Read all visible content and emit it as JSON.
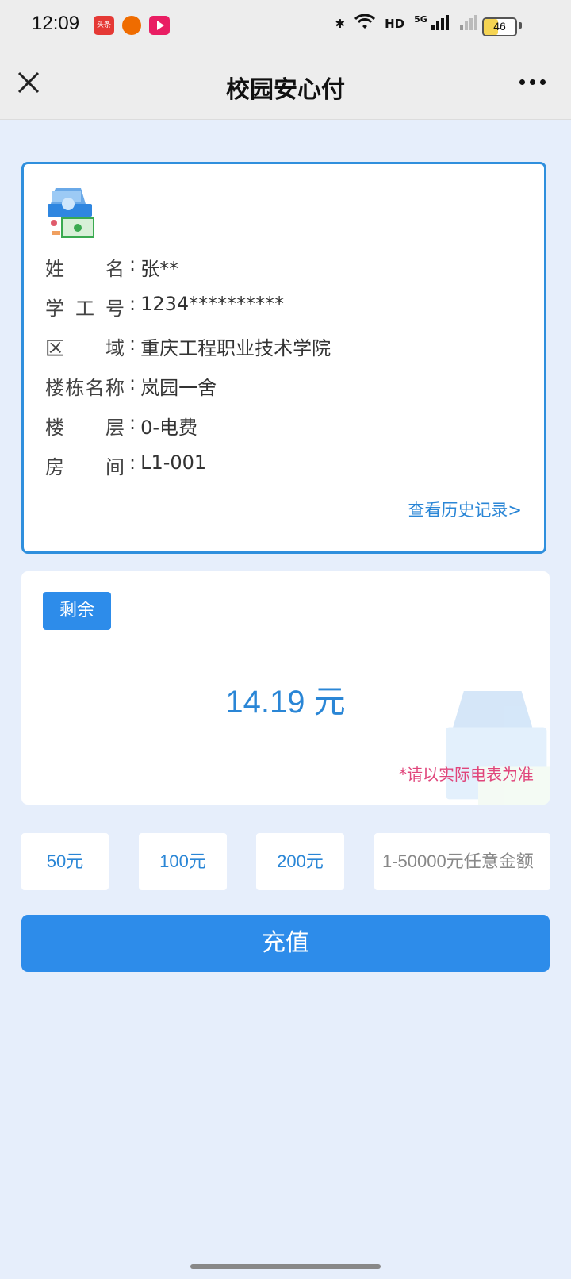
{
  "status_bar": {
    "time": "12:09",
    "app1_label": "头条",
    "battery_level": "46",
    "battery_fraction": 0.46,
    "network_label": "5G",
    "hd_label": "HD"
  },
  "navbar": {
    "title": "校园安心付"
  },
  "info": {
    "rows": [
      {
        "label": "姓名",
        "value": "张**"
      },
      {
        "label": "学工号",
        "value": "1234**********"
      },
      {
        "label": "区域",
        "value": "重庆工程职业技术学院"
      },
      {
        "label": "楼栋名称",
        "value": "岚园一舍"
      },
      {
        "label": "楼层",
        "value": "0-电费"
      },
      {
        "label": "房间",
        "value": "L1-001"
      }
    ],
    "history_link": "查看历史记录>"
  },
  "balance": {
    "badge": "剩余",
    "value": "14.19 元",
    "note": "*请以实际电表为准"
  },
  "amounts": {
    "options": [
      "50元",
      "100元",
      "200元"
    ],
    "custom_placeholder": "1-50000元任意金额"
  },
  "recharge_button": "充值",
  "colors": {
    "accent": "#2d8cea",
    "link": "#2a86d6",
    "note": "#e0457b",
    "background": "#e6eefb"
  }
}
